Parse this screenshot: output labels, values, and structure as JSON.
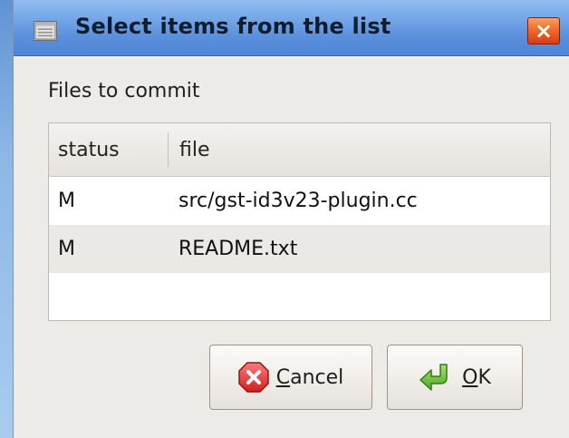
{
  "window": {
    "title": "Select items from the list",
    "close_glyph": "×"
  },
  "content": {
    "label": "Files to commit",
    "columns": {
      "status": "status",
      "file": "file"
    },
    "rows": [
      {
        "status": "M",
        "file": "src/gst-id3v23-plugin.cc"
      },
      {
        "status": "M",
        "file": "README.txt"
      }
    ]
  },
  "buttons": {
    "cancel": {
      "mnemonic": "C",
      "rest": "ancel"
    },
    "ok": {
      "mnemonic": "O",
      "rest": "K"
    }
  },
  "icons": {
    "window": "window-icon",
    "close": "close-icon",
    "cancel": "cancel-icon",
    "ok": "ok-icon"
  },
  "colors": {
    "titlebar": "#5b90dc",
    "close_button": "#e45b23",
    "cancel_icon": "#d92d2d",
    "ok_icon": "#62b32c",
    "window_bg": "#edebe7"
  }
}
